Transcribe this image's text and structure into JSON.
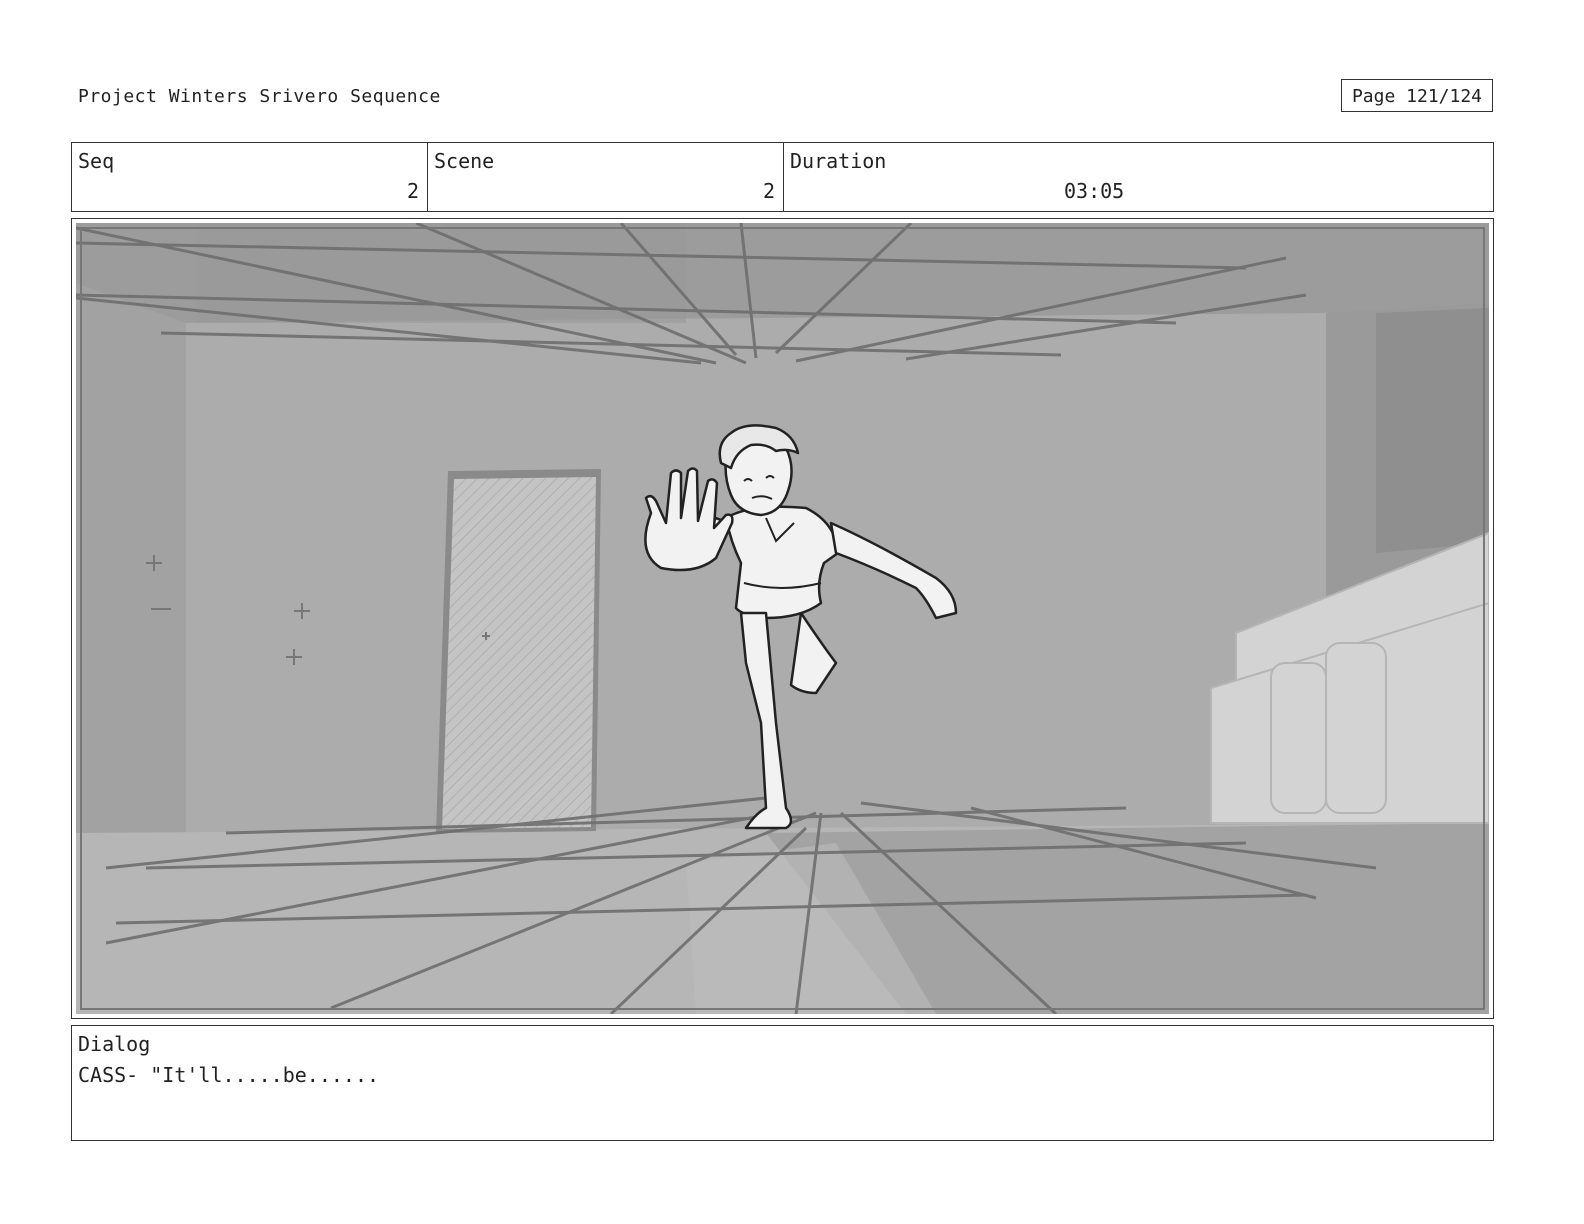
{
  "header": {
    "project_title": "Project Winters Srivero Sequence",
    "page_label": "Page 121/124"
  },
  "info": {
    "seq_label": "Seq",
    "seq_value": "2",
    "scene_label": "Scene",
    "scene_value": "2",
    "duration_label": "Duration",
    "duration_value": "03:05"
  },
  "dialog": {
    "label": "Dialog",
    "text": "CASS- \"It'll.....be......"
  }
}
